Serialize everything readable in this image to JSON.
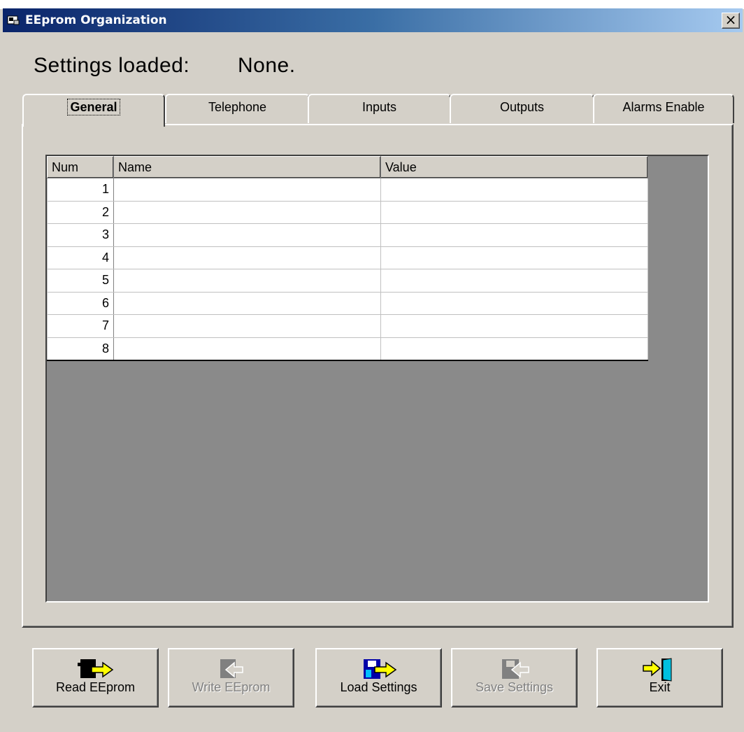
{
  "window": {
    "title": "EEprom Organization",
    "close_symbol": "×"
  },
  "status": {
    "label": "Settings loaded:",
    "value": "None."
  },
  "tabs": [
    {
      "label": "General",
      "active": true
    },
    {
      "label": "Telephone",
      "active": false
    },
    {
      "label": "Inputs",
      "active": false
    },
    {
      "label": "Outputs",
      "active": false
    },
    {
      "label": "Alarms Enable",
      "active": false
    }
  ],
  "grid": {
    "columns": [
      "Num",
      "Name",
      "Value"
    ],
    "rows": [
      {
        "num": "1",
        "name": "",
        "value": ""
      },
      {
        "num": "2",
        "name": "",
        "value": ""
      },
      {
        "num": "3",
        "name": "",
        "value": ""
      },
      {
        "num": "4",
        "name": "",
        "value": ""
      },
      {
        "num": "5",
        "name": "",
        "value": ""
      },
      {
        "num": "6",
        "name": "",
        "value": ""
      },
      {
        "num": "7",
        "name": "",
        "value": ""
      },
      {
        "num": "8",
        "name": "",
        "value": ""
      }
    ]
  },
  "buttons": [
    {
      "label": "Read EEprom",
      "enabled": true,
      "icon": "read-eeprom-icon"
    },
    {
      "label": "Write EEprom",
      "enabled": false,
      "icon": "write-eeprom-icon"
    },
    {
      "label": "Load Settings",
      "enabled": true,
      "icon": "load-settings-icon"
    },
    {
      "label": "Save Settings",
      "enabled": false,
      "icon": "save-settings-icon"
    },
    {
      "label": "Exit",
      "enabled": true,
      "icon": "exit-door-icon"
    }
  ],
  "colors": {
    "titlebar_start": "#0a246a",
    "titlebar_end": "#a6caf0",
    "face": "#d4d0c8",
    "grid_bg": "#8a8a8a",
    "arrow": "#ffff00"
  }
}
